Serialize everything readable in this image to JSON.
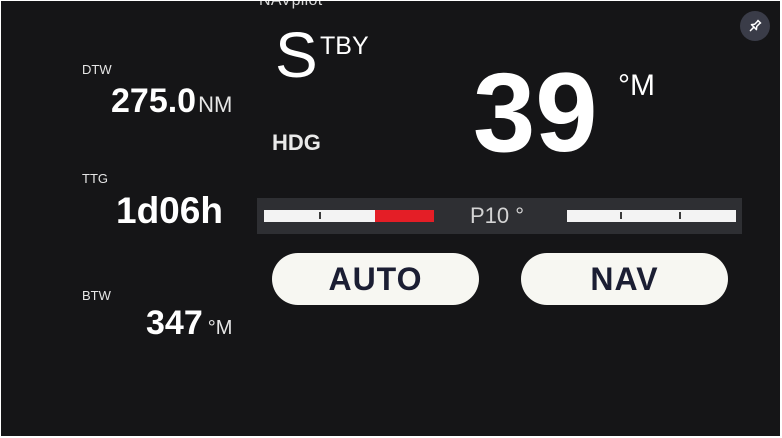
{
  "app": {
    "title": "NAVpilot"
  },
  "pin": {
    "icon": "pin-icon"
  },
  "dtw": {
    "label": "DTW",
    "value": "275.0",
    "unit": "NM"
  },
  "ttg": {
    "label": "TTG",
    "value": "1d06h"
  },
  "btw": {
    "label": "BTW",
    "value": "347",
    "unit": "°M"
  },
  "mode": {
    "letter": "S",
    "rest": "TBY"
  },
  "heading": {
    "label": "HDG",
    "value": "39",
    "unit": "°M"
  },
  "rudder": {
    "text": "P10 °",
    "port_fraction": 0.35,
    "color": "#e41e26"
  },
  "buttons": {
    "auto": "AUTO",
    "nav": "NAV"
  },
  "colors": {
    "background": "#151517",
    "accent": "#e41e26",
    "button": "#f7f7f2",
    "button_text": "#1b1e33"
  }
}
